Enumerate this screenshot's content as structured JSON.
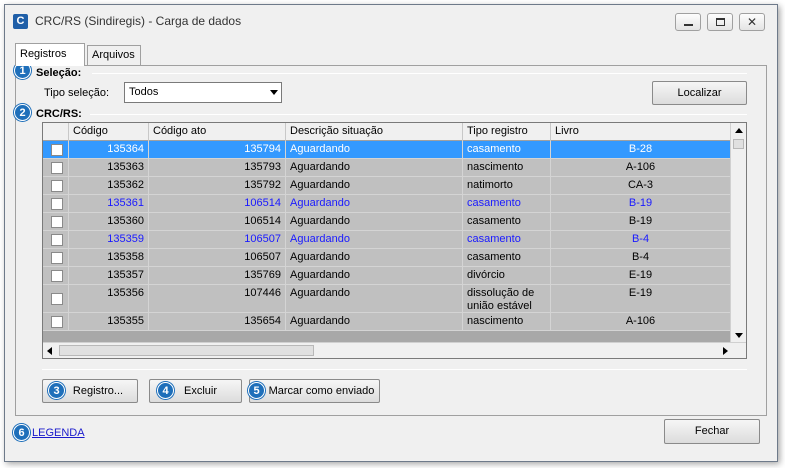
{
  "window": {
    "icon_letter": "C",
    "title": "CRC/RS (Sindiregis) - Carga de dados",
    "close_glyph": "✕"
  },
  "tabs": [
    {
      "label": "Registros",
      "active": true
    },
    {
      "label": "Arquivos",
      "active": false
    }
  ],
  "badges": [
    "1",
    "2",
    "3",
    "4",
    "5",
    "6"
  ],
  "selecao": {
    "heading": "Seleção:",
    "tipo_label": "Tipo seleção:",
    "tipo_value": "Todos",
    "localizar_label": "Localizar"
  },
  "crc": {
    "heading": "CRC/RS:"
  },
  "grid": {
    "columns": [
      "Código",
      "Código ato",
      "Descrição situação",
      "Tipo registro",
      "Livro"
    ],
    "rows": [
      {
        "codigo": "135364",
        "codigo_ato": "135794",
        "situacao": "Aguardando",
        "tipo": "casamento",
        "livro": "B-28",
        "state": "selected"
      },
      {
        "codigo": "135363",
        "codigo_ato": "135793",
        "situacao": "Aguardando",
        "tipo": "nascimento",
        "livro": "A-106",
        "state": "normal"
      },
      {
        "codigo": "135362",
        "codigo_ato": "135792",
        "situacao": "Aguardando",
        "tipo": "natimorto",
        "livro": "CA-3",
        "state": "normal"
      },
      {
        "codigo": "135361",
        "codigo_ato": "106514",
        "situacao": "Aguardando",
        "tipo": "casamento",
        "livro": "B-19",
        "state": "blue"
      },
      {
        "codigo": "135360",
        "codigo_ato": "106514",
        "situacao": "Aguardando",
        "tipo": "casamento",
        "livro": "B-19",
        "state": "normal"
      },
      {
        "codigo": "135359",
        "codigo_ato": "106507",
        "situacao": "Aguardando",
        "tipo": "casamento",
        "livro": "B-4",
        "state": "blue"
      },
      {
        "codigo": "135358",
        "codigo_ato": "106507",
        "situacao": "Aguardando",
        "tipo": "casamento",
        "livro": "B-4",
        "state": "normal"
      },
      {
        "codigo": "135357",
        "codigo_ato": "135769",
        "situacao": "Aguardando",
        "tipo": "divórcio",
        "livro": "E-19",
        "state": "normal"
      },
      {
        "codigo": "135356",
        "codigo_ato": "107446",
        "situacao": "Aguardando",
        "tipo": "dissolução de união estável",
        "livro": "E-19",
        "state": "normal"
      },
      {
        "codigo": "135355",
        "codigo_ato": "135654",
        "situacao": "Aguardando",
        "tipo": "nascimento",
        "livro": "A-106",
        "state": "normal"
      }
    ]
  },
  "actions": {
    "registro_label": "Registro...",
    "excluir_label": "Excluir",
    "marcar_label": "Marcar como enviado",
    "fechar_label": "Fechar"
  },
  "legenda_label": "LEGENDA"
}
